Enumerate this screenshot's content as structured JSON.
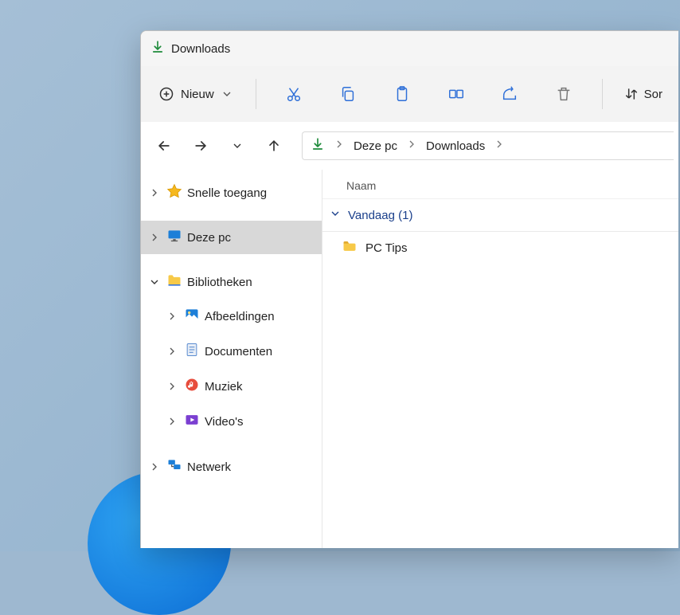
{
  "titlebar": {
    "title": "Downloads"
  },
  "toolbar": {
    "new_label": "Nieuw",
    "sort_label": "Sor"
  },
  "breadcrumb": {
    "items": [
      "Deze pc",
      "Downloads"
    ]
  },
  "sidebar": {
    "quick_access": "Snelle toegang",
    "this_pc": "Deze pc",
    "libraries": "Bibliotheken",
    "lib_items": [
      {
        "label": "Afbeeldingen"
      },
      {
        "label": "Documenten"
      },
      {
        "label": "Muziek"
      },
      {
        "label": "Video's"
      }
    ],
    "network": "Netwerk"
  },
  "content": {
    "column_name": "Naam",
    "group_label": "Vandaag (1)",
    "files": [
      {
        "name": "PC Tips"
      }
    ]
  }
}
